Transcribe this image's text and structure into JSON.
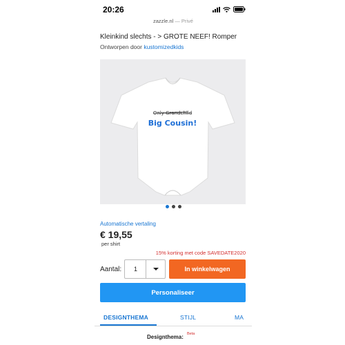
{
  "status_bar": {
    "time": "20:26"
  },
  "browser": {
    "domain": "zazzle.nl",
    "separator": " — ",
    "mode": "Privé"
  },
  "product": {
    "title": "Kleinkind slechts - > GROTE NEEF! Romper",
    "designer_prefix": "Ontworpen door ",
    "designer_name": "kustomizedkids",
    "image": {
      "struck_text": "Only Grandchild",
      "main_text": "Big Cousin!",
      "struck_color": "#333333",
      "main_color": "#1e6fd6"
    },
    "carousel": {
      "count": 3,
      "active_index": 0
    },
    "auto_translate": "Automatische vertaling",
    "price": "€ 19,55",
    "per_unit": "per shirt",
    "discount": "15% korting met code SAVEDATE2020"
  },
  "purchase": {
    "quantity_label": "Aantal:",
    "quantity_value": "1",
    "cart_label": "In winkelwagen",
    "personalise_label": "Personaliseer"
  },
  "tabs": [
    {
      "label": "DESIGNTHEMA",
      "active": true
    },
    {
      "label": "STIJL",
      "active": false
    },
    {
      "label": "MA",
      "active": false
    }
  ],
  "footer": {
    "heading": "Designthema:",
    "badge": "Beta"
  },
  "colors": {
    "accent_blue": "#2196f3",
    "link_blue": "#1976d2",
    "cart_orange": "#f26722",
    "discount_red": "#d32f2f"
  }
}
